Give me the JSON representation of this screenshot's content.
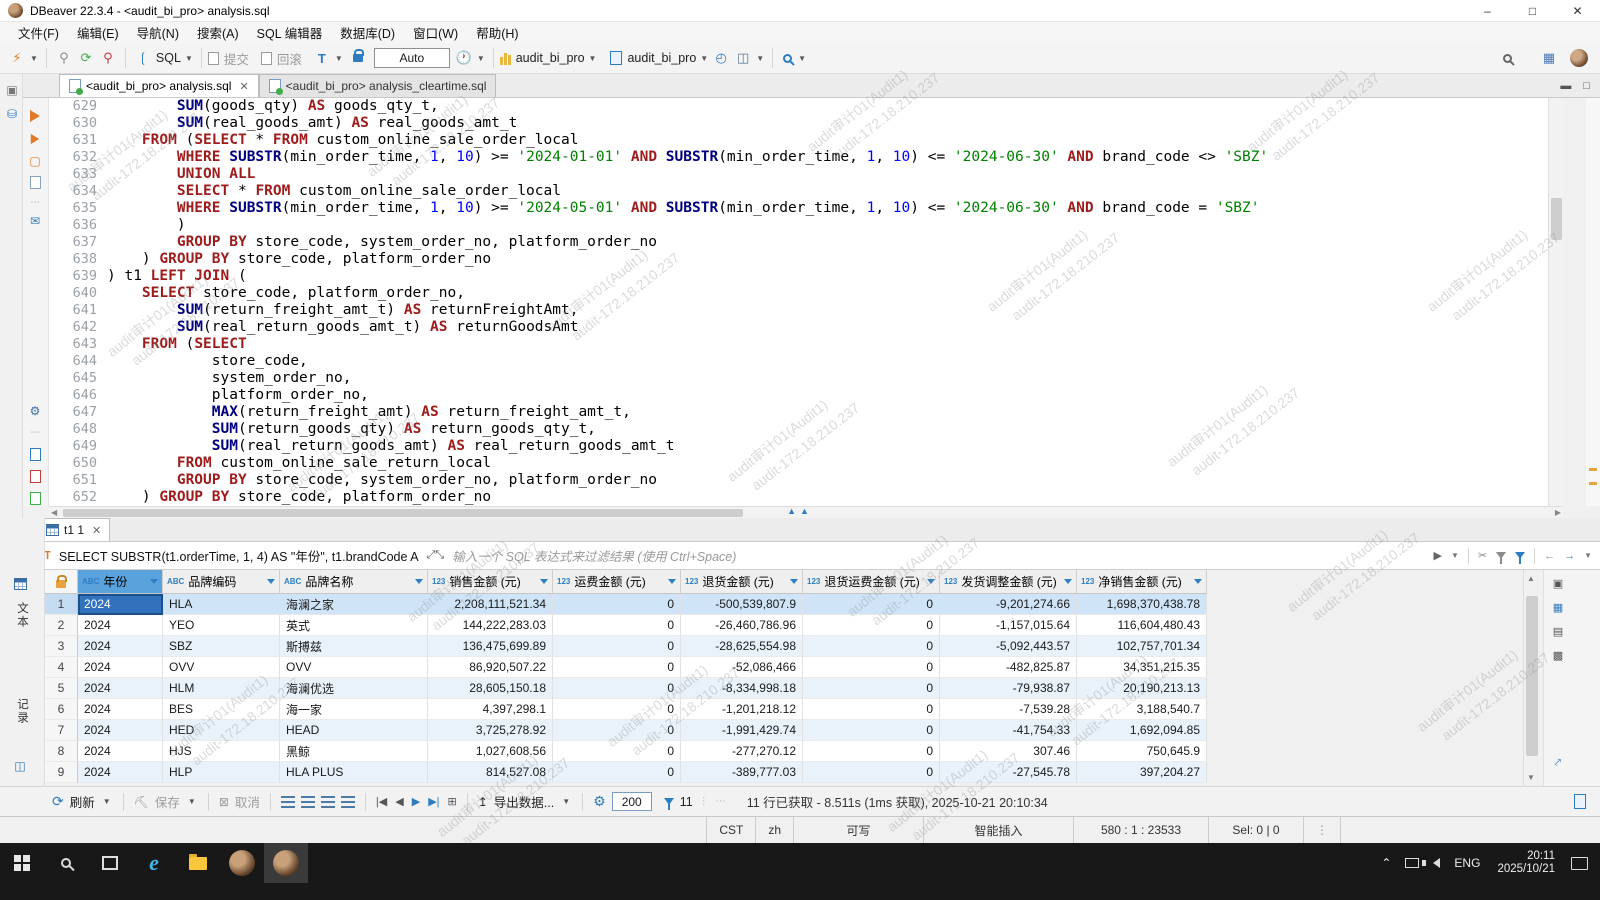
{
  "window": {
    "title": "DBeaver 22.3.4 - <audit_bi_pro> analysis.sql"
  },
  "menu": [
    "文件(F)",
    "编辑(E)",
    "导航(N)",
    "搜索(A)",
    "SQL 编辑器",
    "数据库(D)",
    "窗口(W)",
    "帮助(H)"
  ],
  "toolbar": {
    "sql": "SQL",
    "commit": "提交",
    "rollback": "回滚",
    "tx_mode": "Auto",
    "database": "audit_bi_pro",
    "schema": "audit_bi_pro"
  },
  "editor_tabs": [
    {
      "label": "<audit_bi_pro> analysis.sql"
    },
    {
      "label": "<audit_bi_pro> analysis_cleartime.sql"
    }
  ],
  "watermark": {
    "line1": "audit审计01(Audit1)",
    "line2": "audit-172.18.210.237"
  },
  "editor": {
    "lines": [
      {
        "no": 629,
        "t": [
          [
            "p",
            "        "
          ],
          [
            "f",
            "SUM"
          ],
          [
            "p",
            "(goods_qty) "
          ],
          [
            "k",
            "AS"
          ],
          [
            "p",
            " goods_qty_t,"
          ]
        ]
      },
      {
        "no": 630,
        "t": [
          [
            "p",
            "        "
          ],
          [
            "f",
            "SUM"
          ],
          [
            "p",
            "(real_goods_amt) "
          ],
          [
            "k",
            "AS"
          ],
          [
            "p",
            " real_goods_amt_t"
          ]
        ]
      },
      {
        "no": 631,
        "t": [
          [
            "p",
            "    "
          ],
          [
            "k",
            "FROM"
          ],
          [
            "p",
            " ("
          ],
          [
            "k",
            "SELECT"
          ],
          [
            "p",
            " * "
          ],
          [
            "k",
            "FROM"
          ],
          [
            "p",
            " custom_online_sale_order_local"
          ]
        ]
      },
      {
        "no": 632,
        "t": [
          [
            "p",
            "        "
          ],
          [
            "k",
            "WHERE"
          ],
          [
            "p",
            " "
          ],
          [
            "f",
            "SUBSTR"
          ],
          [
            "p",
            "(min_order_time, "
          ],
          [
            "n",
            "1"
          ],
          [
            "p",
            ", "
          ],
          [
            "n",
            "10"
          ],
          [
            "p",
            ") >= "
          ],
          [
            "s",
            "'2024-01-01'"
          ],
          [
            "p",
            " "
          ],
          [
            "k",
            "AND"
          ],
          [
            "p",
            " "
          ],
          [
            "f",
            "SUBSTR"
          ],
          [
            "p",
            "(min_order_time, "
          ],
          [
            "n",
            "1"
          ],
          [
            "p",
            ", "
          ],
          [
            "n",
            "10"
          ],
          [
            "p",
            ") <= "
          ],
          [
            "s",
            "'2024-06-30'"
          ],
          [
            "p",
            " "
          ],
          [
            "k",
            "AND"
          ],
          [
            "p",
            " brand_code <> "
          ],
          [
            "s",
            "'SBZ'"
          ]
        ]
      },
      {
        "no": 633,
        "t": [
          [
            "p",
            "        "
          ],
          [
            "k",
            "UNION ALL"
          ]
        ]
      },
      {
        "no": 634,
        "t": [
          [
            "p",
            "        "
          ],
          [
            "k",
            "SELECT"
          ],
          [
            "p",
            " * "
          ],
          [
            "k",
            "FROM"
          ],
          [
            "p",
            " custom_online_sale_order_local"
          ]
        ]
      },
      {
        "no": 635,
        "t": [
          [
            "p",
            "        "
          ],
          [
            "k",
            "WHERE"
          ],
          [
            "p",
            " "
          ],
          [
            "f",
            "SUBSTR"
          ],
          [
            "p",
            "(min_order_time, "
          ],
          [
            "n",
            "1"
          ],
          [
            "p",
            ", "
          ],
          [
            "n",
            "10"
          ],
          [
            "p",
            ") >= "
          ],
          [
            "s",
            "'2024-05-01'"
          ],
          [
            "p",
            " "
          ],
          [
            "k",
            "AND"
          ],
          [
            "p",
            " "
          ],
          [
            "f",
            "SUBSTR"
          ],
          [
            "p",
            "(min_order_time, "
          ],
          [
            "n",
            "1"
          ],
          [
            "p",
            ", "
          ],
          [
            "n",
            "10"
          ],
          [
            "p",
            ") <= "
          ],
          [
            "s",
            "'2024-06-30'"
          ],
          [
            "p",
            " "
          ],
          [
            "k",
            "AND"
          ],
          [
            "p",
            " brand_code = "
          ],
          [
            "s",
            "'SBZ'"
          ]
        ]
      },
      {
        "no": 636,
        "t": [
          [
            "p",
            "        )"
          ]
        ]
      },
      {
        "no": 637,
        "t": [
          [
            "p",
            "        "
          ],
          [
            "k",
            "GROUP BY"
          ],
          [
            "p",
            " store_code, system_order_no, platform_order_no"
          ]
        ]
      },
      {
        "no": 638,
        "t": [
          [
            "p",
            "    ) "
          ],
          [
            "k",
            "GROUP BY"
          ],
          [
            "p",
            " store_code, platform_order_no"
          ]
        ]
      },
      {
        "no": 639,
        "t": [
          [
            "p",
            ") t1 "
          ],
          [
            "k",
            "LEFT JOIN"
          ],
          [
            "p",
            " ("
          ]
        ]
      },
      {
        "no": 640,
        "t": [
          [
            "p",
            "    "
          ],
          [
            "k",
            "SELECT"
          ],
          [
            "p",
            " store_code, platform_order_no,"
          ]
        ]
      },
      {
        "no": 641,
        "t": [
          [
            "p",
            "        "
          ],
          [
            "f",
            "SUM"
          ],
          [
            "p",
            "(return_freight_amt_t) "
          ],
          [
            "k",
            "AS"
          ],
          [
            "p",
            " returnFreightAmt,"
          ]
        ]
      },
      {
        "no": 642,
        "t": [
          [
            "p",
            "        "
          ],
          [
            "f",
            "SUM"
          ],
          [
            "p",
            "(real_return_goods_amt_t) "
          ],
          [
            "k",
            "AS"
          ],
          [
            "p",
            " returnGoodsAmt"
          ]
        ]
      },
      {
        "no": 643,
        "t": [
          [
            "p",
            "    "
          ],
          [
            "k",
            "FROM"
          ],
          [
            "p",
            " ("
          ],
          [
            "k",
            "SELECT"
          ]
        ]
      },
      {
        "no": 644,
        "t": [
          [
            "p",
            "            store_code,"
          ]
        ]
      },
      {
        "no": 645,
        "t": [
          [
            "p",
            "            system_order_no,"
          ]
        ]
      },
      {
        "no": 646,
        "t": [
          [
            "p",
            "            platform_order_no,"
          ]
        ]
      },
      {
        "no": 647,
        "t": [
          [
            "p",
            "            "
          ],
          [
            "f",
            "MAX"
          ],
          [
            "p",
            "(return_freight_amt) "
          ],
          [
            "k",
            "AS"
          ],
          [
            "p",
            " return_freight_amt_t,"
          ]
        ]
      },
      {
        "no": 648,
        "t": [
          [
            "p",
            "            "
          ],
          [
            "f",
            "SUM"
          ],
          [
            "p",
            "(return_goods_qty) "
          ],
          [
            "k",
            "AS"
          ],
          [
            "p",
            " return_goods_qty_t,"
          ]
        ]
      },
      {
        "no": 649,
        "t": [
          [
            "p",
            "            "
          ],
          [
            "f",
            "SUM"
          ],
          [
            "p",
            "(real_return_goods_amt) "
          ],
          [
            "k",
            "AS"
          ],
          [
            "p",
            " real_return_goods_amt_t"
          ]
        ]
      },
      {
        "no": 650,
        "t": [
          [
            "p",
            "        "
          ],
          [
            "k",
            "FROM"
          ],
          [
            "p",
            " custom_online_sale_return_local"
          ]
        ]
      },
      {
        "no": 651,
        "t": [
          [
            "p",
            "        "
          ],
          [
            "k",
            "GROUP BY"
          ],
          [
            "p",
            " store_code, system_order_no, platform_order_no"
          ]
        ]
      },
      {
        "no": 652,
        "t": [
          [
            "p",
            "    ) "
          ],
          [
            "k",
            "GROUP BY"
          ],
          [
            "p",
            " store_code, platform_order_no"
          ]
        ]
      }
    ]
  },
  "results": {
    "tab_label": "t1 1",
    "filter_sql": "SELECT SUBSTR(t1.orderTime, 1, 4) AS \"年份\", t1.brandCode A",
    "filter_placeholder": "输入一个 SQL 表达式来过滤结果 (使用 Ctrl+Space)",
    "side": {
      "text_tab": "文本",
      "record_tab": "记录"
    },
    "columns": [
      {
        "type": "ABC",
        "label": "年份",
        "selected": true
      },
      {
        "type": "ABC",
        "label": "品牌编码"
      },
      {
        "type": "ABC",
        "label": "品牌名称"
      },
      {
        "type": "123",
        "label": "销售金额 (元)"
      },
      {
        "type": "123",
        "label": "运费金额 (元)"
      },
      {
        "type": "123",
        "label": "退货金额 (元)"
      },
      {
        "type": "123",
        "label": "退货运费金额 (元)"
      },
      {
        "type": "123",
        "label": "发货调整金额 (元)"
      },
      {
        "type": "123",
        "label": "净销售金额 (元)"
      }
    ],
    "rows": [
      [
        "2024",
        "HLA",
        "海澜之家",
        "2,208,111,521.34",
        "0",
        "-500,539,807.9",
        "0",
        "-9,201,274.66",
        "1,698,370,438.78"
      ],
      [
        "2024",
        "YEO",
        "英式",
        "144,222,283.03",
        "0",
        "-26,460,786.96",
        "0",
        "-1,157,015.64",
        "116,604,480.43"
      ],
      [
        "2024",
        "SBZ",
        "斯搏兹",
        "136,475,699.89",
        "0",
        "-28,625,554.98",
        "0",
        "-5,092,443.57",
        "102,757,701.34"
      ],
      [
        "2024",
        "OVV",
        "OVV",
        "86,920,507.22",
        "0",
        "-52,086,466",
        "0",
        "-482,825.87",
        "34,351,215.35"
      ],
      [
        "2024",
        "HLM",
        "海澜优选",
        "28,605,150.18",
        "0",
        "-8,334,998.18",
        "0",
        "-79,938.87",
        "20,190,213.13"
      ],
      [
        "2024",
        "BES",
        "海一家",
        "4,397,298.1",
        "0",
        "-1,201,218.12",
        "0",
        "-7,539.28",
        "3,188,540.7"
      ],
      [
        "2024",
        "HED",
        "HEAD",
        "3,725,278.92",
        "0",
        "-1,991,429.74",
        "0",
        "-41,754.33",
        "1,692,094.85"
      ],
      [
        "2024",
        "HJS",
        "黑鲸",
        "1,027,608.56",
        "0",
        "-277,270.12",
        "0",
        "307.46",
        "750,645.9"
      ],
      [
        "2024",
        "HLP",
        "HLA PLUS",
        "814,527.08",
        "0",
        "-389,777.03",
        "0",
        "-27,545.78",
        "397,204.27"
      ]
    ],
    "footer": {
      "refresh": "刷新",
      "save": "保存",
      "cancel": "取消",
      "export": "导出数据...",
      "fetch_size": "200",
      "filter_count": "11",
      "status": "11 行已获取 - 8.511s (1ms 获取), 2025-10-21 20:10:34"
    }
  },
  "statusbar": {
    "items": [
      "CST",
      "zh",
      "可写",
      "智能插入",
      "580 : 1 : 23533",
      "Sel: 0 | 0"
    ]
  },
  "taskbar": {
    "lang": "ENG",
    "time": "20:11",
    "date": "2025/10/21"
  }
}
